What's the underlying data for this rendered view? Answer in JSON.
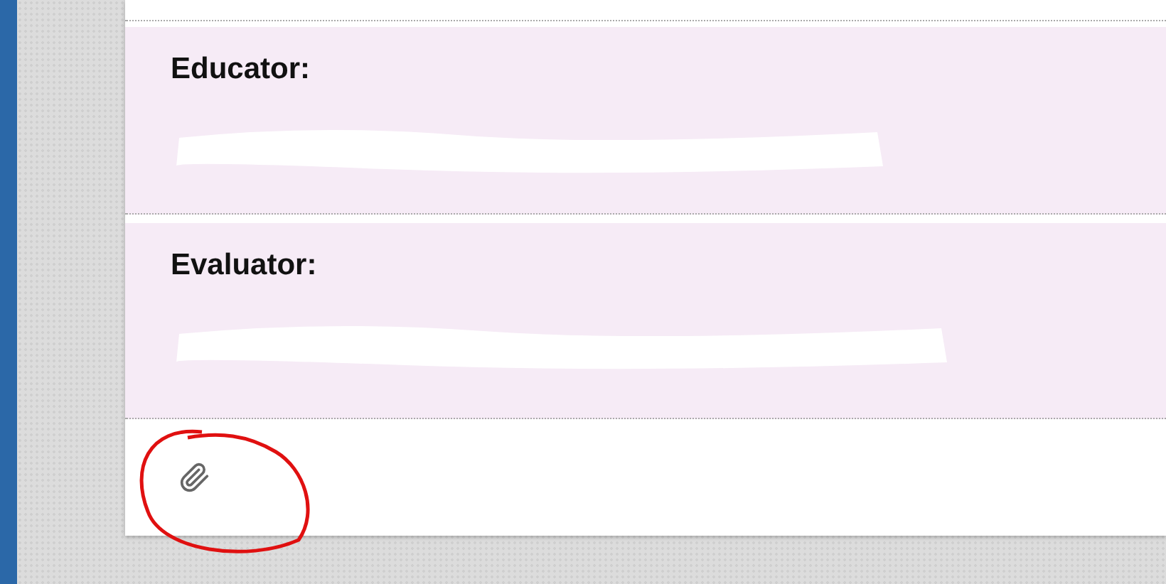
{
  "sections": [
    {
      "label": "Educator:"
    },
    {
      "label": "Evaluator:"
    }
  ],
  "attachment": {
    "annotated": true
  }
}
